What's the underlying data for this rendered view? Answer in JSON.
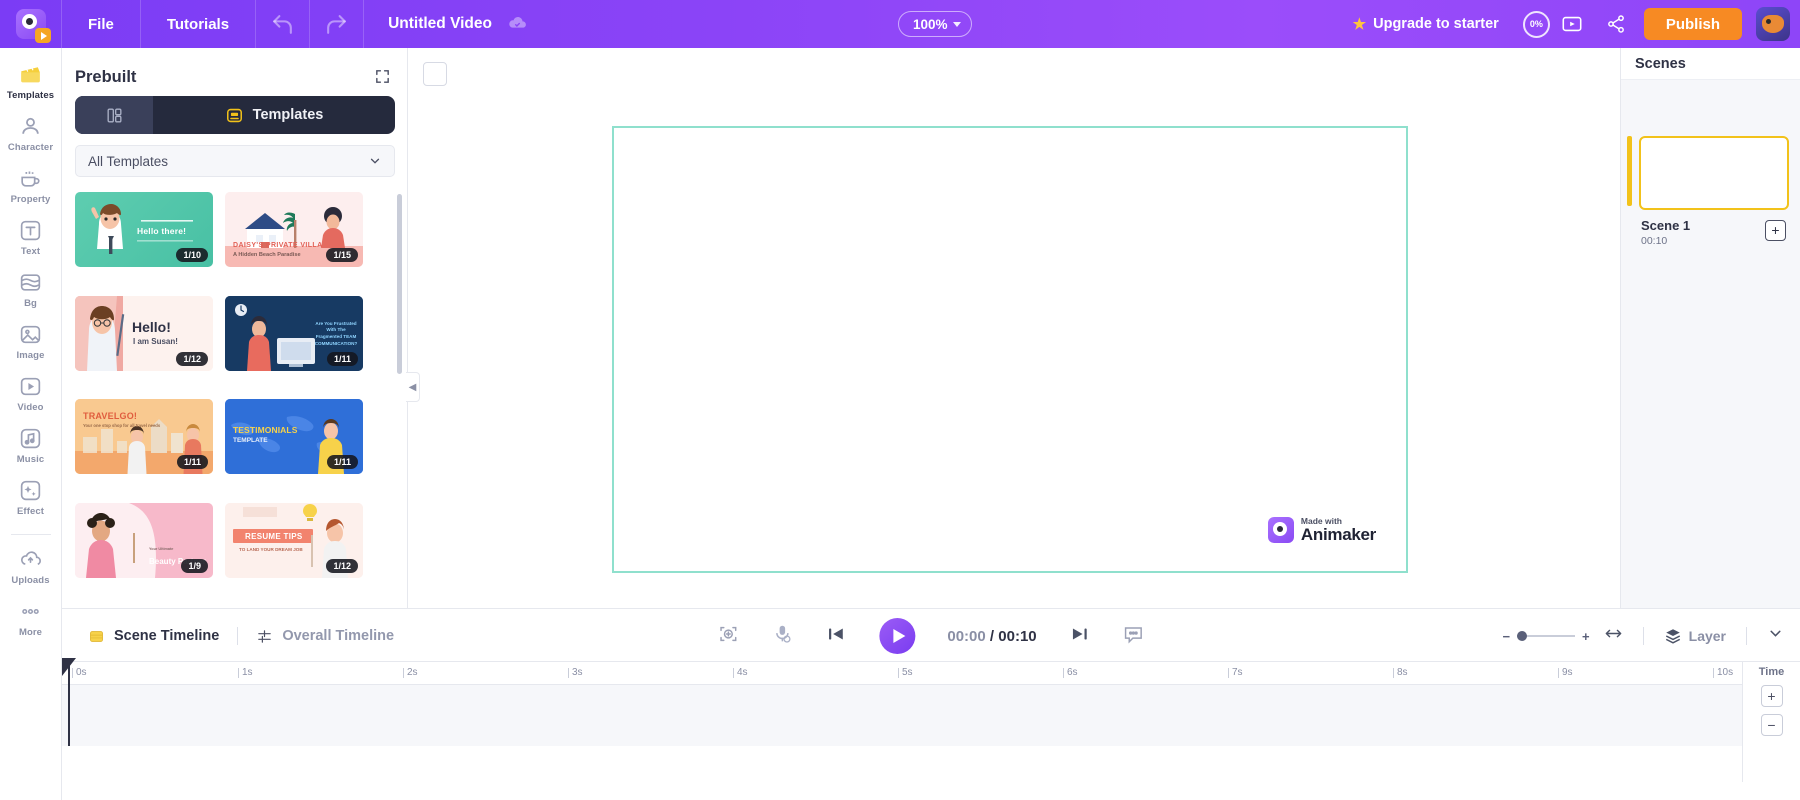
{
  "app": {
    "brand": "Animaker",
    "logo_icon": "animaker-logo-icon"
  },
  "topbar": {
    "menu": [
      {
        "label": "File",
        "name": "menu-file"
      },
      {
        "label": "Tutorials",
        "name": "menu-tutorials"
      }
    ],
    "undo_icon": "undo-icon",
    "redo_icon": "redo-icon",
    "project_title": "Untitled Video",
    "cloud_saved_icon": "cloud-saved-icon",
    "zoom_value": "100%",
    "zoom_caret_icon": "chevron-down-icon",
    "upgrade_label": "Upgrade to starter",
    "upgrade_star_icon": "star-icon",
    "usage_percent": "0%",
    "present_icon": "present-play-icon",
    "share_icon": "share-icon",
    "publish_label": "Publish",
    "avatar_icon": "user-avatar"
  },
  "rail": {
    "items": [
      {
        "label": "Templates",
        "icon": "templates-icon",
        "active": true
      },
      {
        "label": "Character",
        "icon": "character-icon",
        "active": false
      },
      {
        "label": "Property",
        "icon": "property-icon",
        "active": false
      },
      {
        "label": "Text",
        "icon": "text-icon",
        "active": false
      },
      {
        "label": "Bg",
        "icon": "background-icon",
        "active": false
      },
      {
        "label": "Image",
        "icon": "image-icon",
        "active": false
      },
      {
        "label": "Video",
        "icon": "video-icon",
        "active": false
      },
      {
        "label": "Music",
        "icon": "music-icon",
        "active": false
      },
      {
        "label": "Effect",
        "icon": "effect-icon",
        "active": false
      }
    ],
    "bottom": [
      {
        "label": "Uploads",
        "icon": "uploads-icon"
      },
      {
        "label": "More",
        "icon": "more-dots-icon"
      }
    ]
  },
  "panel": {
    "title": "Prebuilt",
    "expand_icon": "expand-panel-icon",
    "collapse_icon": "collapse-panel-arrow-icon",
    "tab_layouts_icon": "layouts-grid-icon",
    "tab_templates_icon": "templates-frame-icon",
    "tab_templates_label": "Templates",
    "filter_value": "All Templates",
    "filter_caret_icon": "chevron-down-icon",
    "templates": [
      {
        "title": "Hello there!",
        "subtitle": "",
        "badge": "1/10",
        "style": "t1"
      },
      {
        "title": "DAISY'S PRIVATE VILLA",
        "subtitle": "A Hidden Beach Paradise",
        "badge": "1/15",
        "style": "t2"
      },
      {
        "title": "Hello!",
        "subtitle": "I am Susan!",
        "badge": "1/12",
        "style": "t3"
      },
      {
        "title": "Are You Frustrated With The Fragmented TEAM COMMUNICATION?",
        "subtitle": "",
        "badge": "1/11",
        "style": "t4"
      },
      {
        "title": "TRAVELGO!",
        "subtitle": "Your one stop shop for all travel needs",
        "badge": "1/11",
        "style": "t5"
      },
      {
        "title": "TESTIMONIALS",
        "subtitle": "TEMPLATE",
        "badge": "1/11",
        "style": "t6"
      },
      {
        "title": "Beauty Partner",
        "subtitle": "Your Ultimate",
        "badge": "1/9",
        "style": "t7"
      },
      {
        "title": "RESUME TIPS",
        "subtitle": "TO LAND YOUR DREAM JOB",
        "badge": "1/12",
        "style": "t8"
      }
    ]
  },
  "canvas": {
    "frame_chip_icon": "frame-select-icon",
    "watermark_made": "Made with",
    "watermark_brand": "Animaker"
  },
  "scenes": {
    "title": "Scenes",
    "items": [
      {
        "label": "Scene 1",
        "duration": "00:10"
      }
    ],
    "add_label": "+"
  },
  "timeline": {
    "scene_tab_label": "Scene Timeline",
    "scene_tab_icon": "scene-timeline-icon",
    "overall_tab_label": "Overall Timeline",
    "overall_tab_icon": "overall-timeline-icon",
    "add_marker_icon": "add-keyframe-icon",
    "mic_icon": "microphone-icon",
    "prev_icon": "skip-previous-icon",
    "play_icon": "play-icon",
    "next_icon": "skip-next-icon",
    "subtitle_icon": "subtitles-icon",
    "current_time": "00:00",
    "separator": "/",
    "total_time": "00:10",
    "zoom_minus": "−",
    "zoom_plus": "+",
    "fit_icon": "fit-width-icon",
    "layer_icon": "layers-icon",
    "layer_label": "Layer",
    "expand_icon": "chevron-down-icon",
    "ruler_ticks": [
      "0s",
      "1s",
      "2s",
      "3s",
      "4s",
      "5s",
      "6s",
      "7s",
      "8s",
      "9s",
      "10s"
    ],
    "time_col_label": "Time",
    "time_col_plus": "+",
    "time_col_minus": "−"
  },
  "colors": {
    "brand_purple": "#8b44f7",
    "publish_orange": "#f78a23",
    "scene_yellow": "#f2c21a",
    "stage_border": "#8fe0cd",
    "panel_dark": "#252a3d"
  }
}
